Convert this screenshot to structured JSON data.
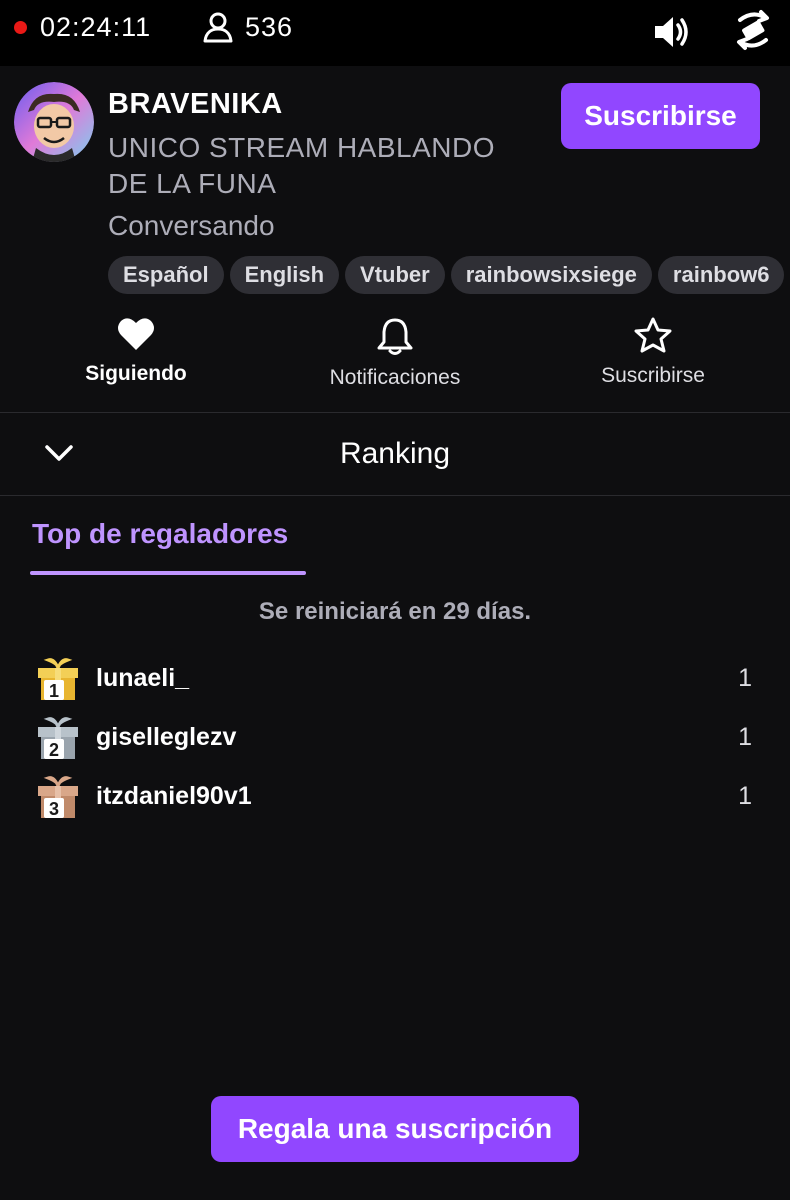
{
  "status_bar": {
    "stream_timer": "02:24:11",
    "viewer_count": "536"
  },
  "channel": {
    "name": "BRAVENIKA",
    "title": "UNICO STREAM HABLANDO DE LA FUNA",
    "category": "Conversando",
    "subscribe_label": "Suscribirse",
    "tags": [
      "Español",
      "English",
      "Vtuber",
      "rainbowsixsiege",
      "rainbow6"
    ]
  },
  "actions": {
    "follow_label": "Siguiendo",
    "notifications_label": "Notificaciones",
    "subscribe_label": "Suscribirse"
  },
  "ranking": {
    "title": "Ranking",
    "tab_label": "Top de regaladores",
    "reset_text": "Se reiniciará en 29 días.",
    "entries": [
      {
        "rank": "1",
        "name": "lunaeli_",
        "count": "1"
      },
      {
        "rank": "2",
        "name": "giselleglezv",
        "count": "1"
      },
      {
        "rank": "3",
        "name": "itzdaniel90v1",
        "count": "1"
      }
    ]
  },
  "gift_button_label": "Regala una suscripción",
  "colors": {
    "accent": "#9147ff",
    "accent_light": "#bf94ff",
    "background": "#0e0e10",
    "live": "#e91916",
    "gold": "#e8b530",
    "silver": "#9aa4ad",
    "bronze": "#c08a6a"
  },
  "icons": [
    "live-dot-icon",
    "viewer-icon",
    "volume-icon",
    "rotate-icon",
    "heart-icon",
    "bell-icon",
    "star-icon",
    "chevron-down-icon",
    "gift-gold-icon",
    "gift-silver-icon",
    "gift-bronze-icon"
  ]
}
